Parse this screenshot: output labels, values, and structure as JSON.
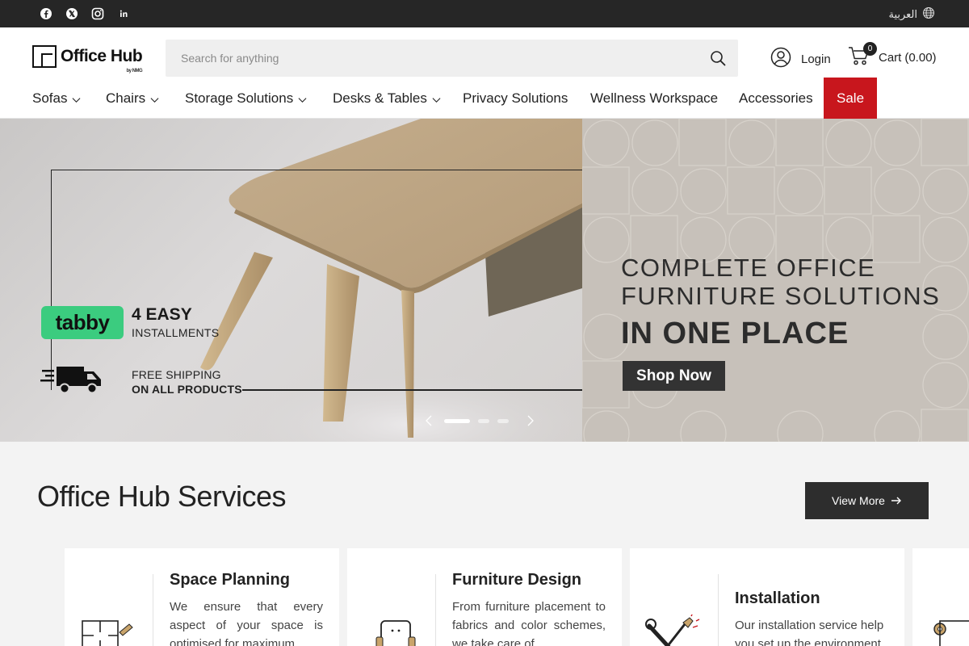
{
  "topbar": {
    "social": [
      "facebook-icon",
      "x-twitter-icon",
      "instagram-icon",
      "linkedin-icon"
    ],
    "language": "العربية"
  },
  "header": {
    "logo_text": "Office Hub",
    "logo_sub": "by NMG",
    "search_placeholder": "Search for anything",
    "login_label": "Login",
    "cart_label": "Cart",
    "cart_total": "(0.00)",
    "cart_count": "0"
  },
  "nav": {
    "items": [
      {
        "label": "Sofas",
        "has_dropdown": true
      },
      {
        "label": "Chairs",
        "has_dropdown": true
      },
      {
        "label": "Storage Solutions",
        "has_dropdown": true
      },
      {
        "label": "Desks & Tables",
        "has_dropdown": true
      },
      {
        "label": "Privacy Solutions",
        "has_dropdown": false
      },
      {
        "label": "Wellness Workspace",
        "has_dropdown": false
      },
      {
        "label": "Accessories",
        "has_dropdown": false
      },
      {
        "label": "Sale",
        "has_dropdown": false
      }
    ],
    "sale_color": "#c8161d"
  },
  "hero": {
    "tabby_logo": "tabby",
    "installments_big": "4 EASY",
    "installments_small": "INSTALLMENTS",
    "shipping_line1": "FREE SHIPPING",
    "shipping_line2": "ON ALL PRODUCTS",
    "headline_line1": "COMPLETE OFFICE",
    "headline_line2": "FURNITURE SOLUTIONS",
    "headline_line3": "IN ONE PLACE",
    "cta": "Shop Now",
    "slides": 3,
    "active_slide": 1
  },
  "services": {
    "title": "Office Hub Services",
    "view_more": "View More",
    "cards": [
      {
        "title": "Space Planning",
        "text": "We ensure that every aspect of your space is optimised for maximum",
        "icon": "floor-plan-icon"
      },
      {
        "title": "Furniture Design",
        "text": "From furniture placement to fabrics and color schemes, we take care of",
        "icon": "armchair-icon"
      },
      {
        "title": "Installation",
        "text": "Our installation service help you set up the environment",
        "icon": "tools-icon"
      }
    ]
  },
  "colors": {
    "topbar": "#262626",
    "sale": "#c8161d",
    "tabby": "#3bcc7f",
    "dark_button": "#2d2d2d"
  }
}
